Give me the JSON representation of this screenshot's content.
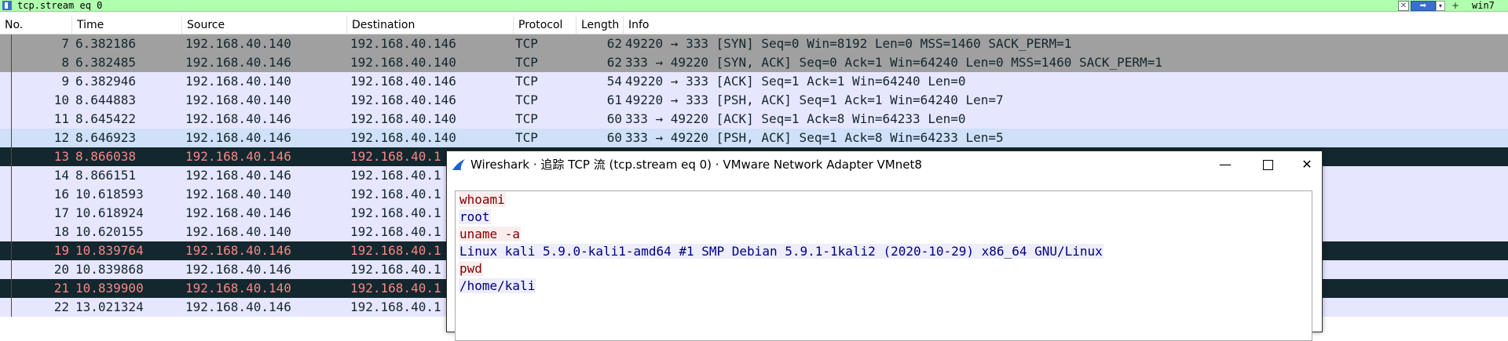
{
  "filter": {
    "value": "tcp.stream eq 0",
    "clear_label": "✕",
    "apply_label": "➡",
    "dropdown_label": "▾",
    "add_label": "+",
    "bookmark_label": "win7"
  },
  "columns": [
    "No.",
    "Time",
    "Source",
    "Destination",
    "Protocol",
    "Length",
    "Info"
  ],
  "packets": [
    {
      "no": "7",
      "time": "6.382186",
      "src": "192.168.40.140",
      "dst": "192.168.40.146",
      "proto": "TCP",
      "len": "62",
      "info": "49220 → 333 [SYN] Seq=0 Win=8192 Len=0 MSS=1460 SACK_PERM=1",
      "color": "syn"
    },
    {
      "no": "8",
      "time": "6.382485",
      "src": "192.168.40.146",
      "dst": "192.168.40.140",
      "proto": "TCP",
      "len": "62",
      "info": "333 → 49220 [SYN, ACK] Seq=0 Ack=1 Win=64240 Len=0 MSS=1460 SACK_PERM=1",
      "color": "syn"
    },
    {
      "no": "9",
      "time": "6.382946",
      "src": "192.168.40.140",
      "dst": "192.168.40.146",
      "proto": "TCP",
      "len": "54",
      "info": "49220 → 333 [ACK] Seq=1 Ack=1 Win=64240 Len=0",
      "color": "tcp"
    },
    {
      "no": "10",
      "time": "8.644883",
      "src": "192.168.40.140",
      "dst": "192.168.40.146",
      "proto": "TCP",
      "len": "61",
      "info": "49220 → 333 [PSH, ACK] Seq=1 Ack=1 Win=64240 Len=7",
      "color": "tcp"
    },
    {
      "no": "11",
      "time": "8.645422",
      "src": "192.168.40.146",
      "dst": "192.168.40.140",
      "proto": "TCP",
      "len": "60",
      "info": "333 → 49220 [ACK] Seq=1 Ack=8 Win=64233 Len=0",
      "color": "tcp"
    },
    {
      "no": "12",
      "time": "8.646923",
      "src": "192.168.40.146",
      "dst": "192.168.40.140",
      "proto": "TCP",
      "len": "60",
      "info": "333 → 49220 [PSH, ACK] Seq=1 Ack=8 Win=64233 Len=5",
      "color": "sel"
    },
    {
      "no": "13",
      "time": "8.866038",
      "src": "192.168.40.146",
      "dst": "192.168.40.1",
      "proto": "",
      "len": "",
      "info": "",
      "color": "bad"
    },
    {
      "no": "14",
      "time": "8.866151",
      "src": "192.168.40.146",
      "dst": "192.168.40.1",
      "proto": "",
      "len": "",
      "info": "",
      "color": "tcp"
    },
    {
      "no": "16",
      "time": "10.618593",
      "src": "192.168.40.140",
      "dst": "192.168.40.1",
      "proto": "",
      "len": "",
      "info": "",
      "color": "tcp"
    },
    {
      "no": "17",
      "time": "10.618924",
      "src": "192.168.40.146",
      "dst": "192.168.40.1",
      "proto": "",
      "len": "",
      "info": "",
      "color": "tcp"
    },
    {
      "no": "18",
      "time": "10.620155",
      "src": "192.168.40.140",
      "dst": "192.168.40.1",
      "proto": "",
      "len": "",
      "info": "",
      "color": "tcp"
    },
    {
      "no": "19",
      "time": "10.839764",
      "src": "192.168.40.146",
      "dst": "192.168.40.1",
      "proto": "",
      "len": "",
      "info": "",
      "color": "bad"
    },
    {
      "no": "20",
      "time": "10.839868",
      "src": "192.168.40.146",
      "dst": "192.168.40.1",
      "proto": "",
      "len": "",
      "info": "",
      "color": "tcp"
    },
    {
      "no": "21",
      "time": "10.839900",
      "src": "192.168.40.140",
      "dst": "192.168.40.1",
      "proto": "",
      "len": "",
      "info": "",
      "color": "bad"
    },
    {
      "no": "22",
      "time": "13.021324",
      "src": "192.168.40.146",
      "dst": "192.168.40.1",
      "proto": "",
      "len": "",
      "info": "",
      "color": "tcp"
    }
  ],
  "dialog": {
    "title": "Wireshark · 追踪 TCP 流 (tcp.stream eq 0) · VMware Network Adapter VMnet8",
    "minimize_label": "—",
    "close_label": "✕",
    "stream": [
      {
        "dir": "client",
        "text": "whoami"
      },
      {
        "dir": "server",
        "text": "root"
      },
      {
        "dir": "client",
        "text": "uname -a"
      },
      {
        "dir": "server",
        "text": "Linux kali 5.9.0-kali1-amd64 #1 SMP Debian 5.9.1-1kali2 (2020-10-29) x86_64 GNU/Linux"
      },
      {
        "dir": "client",
        "text": "pwd"
      },
      {
        "dir": "server",
        "text": "/home/kali"
      }
    ]
  },
  "colors": {
    "filter_valid": "#afffaf",
    "row_syn": "#a0a0a0",
    "row_tcp": "#e7e6ff",
    "row_selected": "#cfe0f8",
    "row_bad": "#12272e",
    "row_bad_text": "#f78787",
    "client_text": "#7f0000",
    "server_text": "#00007f"
  },
  "icons": {
    "filter": "bookmark-icon",
    "dialog": "wireshark-fin-icon"
  }
}
